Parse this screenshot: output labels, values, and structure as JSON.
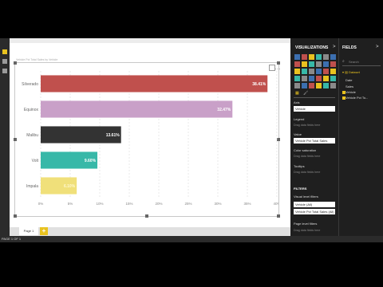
{
  "window": {
    "status": "PAGE 1 OF 1"
  },
  "canvas": {
    "visual_title": "Vehicle Pct Total Sales by Vehicle",
    "page_tab": "Page 1",
    "add_page": "+"
  },
  "chart_data": {
    "type": "bar",
    "orientation": "horizontal",
    "categories": [
      "Silverado",
      "Equinox",
      "Malibu",
      "Volt",
      "Impala"
    ],
    "values": [
      38.41,
      32.47,
      13.61,
      9.6,
      6.1
    ],
    "value_labels": [
      "38.41%",
      "32.47%",
      "13.61%",
      "9.60%",
      "6.10%"
    ],
    "colors": [
      "#c0504d",
      "#c9a0c8",
      "#333333",
      "#37b8a8",
      "#f0e07a"
    ],
    "xlim": [
      0,
      40
    ],
    "ticks": [
      "0%",
      "5%",
      "10%",
      "15%",
      "20%",
      "25%",
      "30%",
      "35%",
      "40%"
    ],
    "grid": true
  },
  "viz_pane": {
    "title": "VISUALIZATIONS",
    "chevron": ">",
    "sections": {
      "axis": "Axis",
      "axis_value": "Vehicle",
      "legend": "Legend",
      "legend_drop": "Drag data fields here",
      "value": "Value",
      "value_field": "Vehicle Pct Total Sales",
      "color_sat": "Color saturation",
      "color_drop": "Drag data fields here",
      "tooltips": "Tooltips",
      "tooltips_drop": "Drag data fields here"
    },
    "filters": {
      "title": "FILTERS",
      "visual_level": "Visual level filters",
      "items": [
        "Vehicle (All)",
        "Vehicle Pct Total Sales (All)"
      ],
      "page_level": "Page level filters",
      "page_drop": "Drag data fields here"
    }
  },
  "fields_pane": {
    "title": "FIELDS",
    "chevron": ">",
    "search_placeholder": "Search",
    "table": "Dataset",
    "items": [
      "Date",
      "Sales",
      "Vehicle",
      "Vehicle Pct To..."
    ]
  },
  "colors": {
    "accent": "#e8c21f",
    "pane_bg": "#1f1f1f"
  }
}
